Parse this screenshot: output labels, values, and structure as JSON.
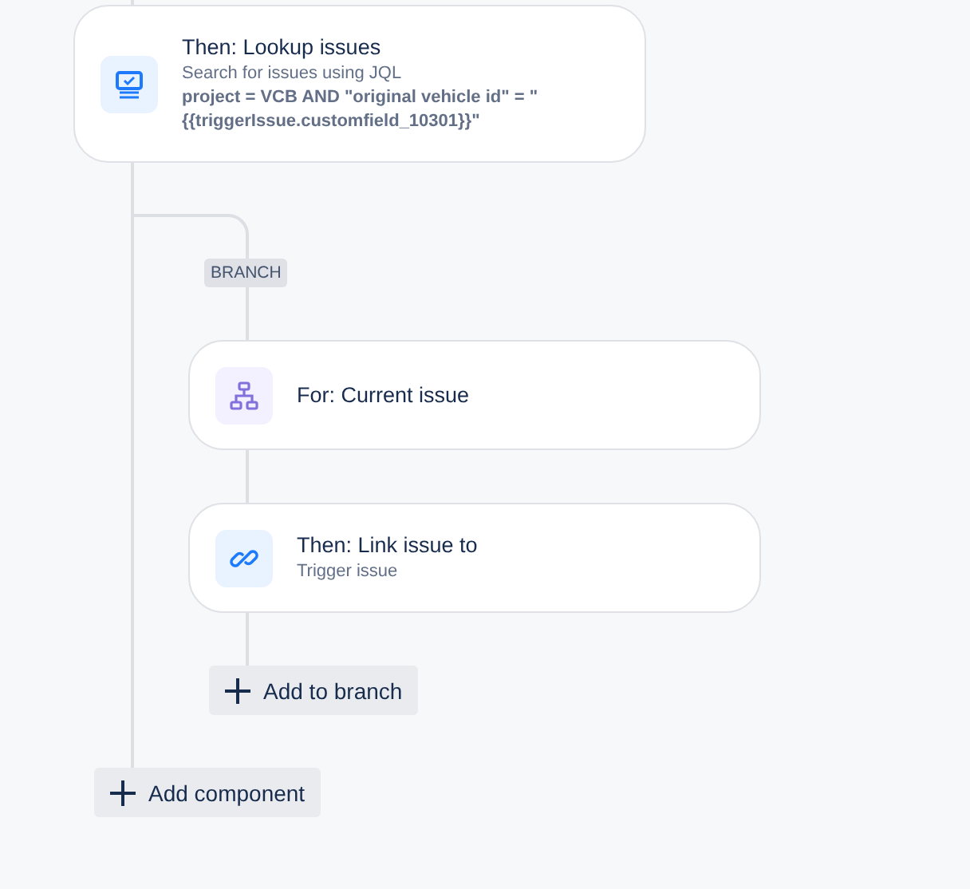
{
  "main_component": {
    "kind": "monitor",
    "title": "Then: Lookup issues",
    "subtitle": "Search for issues using JQL",
    "detail": "project = VCB AND \"original vehicle id\" = \"\n{{triggerIssue.customfield_10301}}\""
  },
  "branch": {
    "label": "BRANCH",
    "components": [
      {
        "kind": "hierarchy",
        "title": "For: Current issue"
      },
      {
        "kind": "link",
        "title": "Then: Link issue to",
        "subtitle": "Trigger issue"
      }
    ],
    "add_button": "Add to branch"
  },
  "add_component_button": "Add component"
}
